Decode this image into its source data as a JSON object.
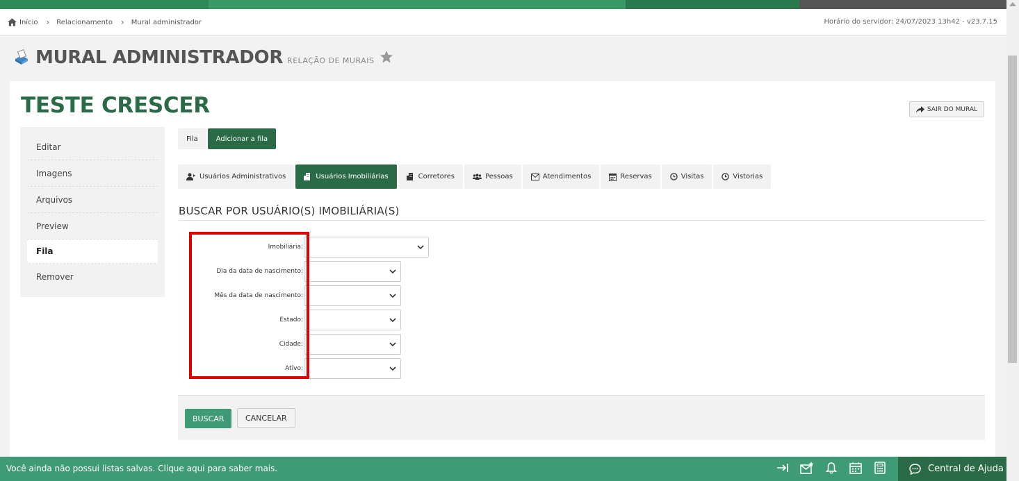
{
  "breadcrumb": {
    "items": [
      "Início",
      "Relacionamento",
      "Mural administrador"
    ]
  },
  "server_time": "Horário do servidor: 24/07/2023 13h42 - v23.7.15",
  "header": {
    "title": "MURAL ADMINISTRADOR",
    "subtitle": "RELAÇÃO DE MURAIS"
  },
  "mural": {
    "title": "TESTE CRESCER",
    "exit_label": "SAIR DO MURAL"
  },
  "sidenav": {
    "items": [
      {
        "label": "Editar",
        "active": false
      },
      {
        "label": "Imagens",
        "active": false
      },
      {
        "label": "Arquivos",
        "active": false
      },
      {
        "label": "Preview",
        "active": false
      },
      {
        "label": "Fila",
        "active": true
      },
      {
        "label": "Remover",
        "active": false
      }
    ]
  },
  "subtabs": [
    {
      "label": "Fila",
      "active": false
    },
    {
      "label": "Adicionar a fila",
      "active": true
    }
  ],
  "tabs": [
    {
      "label": "Usuários Administrativos",
      "icon": "user-arrow-icon",
      "active": false
    },
    {
      "label": "Usuários Imobiliárias",
      "icon": "building-icon",
      "active": true
    },
    {
      "label": "Corretores",
      "icon": "building-icon",
      "active": false
    },
    {
      "label": "Pessoas",
      "icon": "group-icon",
      "active": false
    },
    {
      "label": "Atendimentos",
      "icon": "envelope-icon",
      "active": false
    },
    {
      "label": "Reservas",
      "icon": "calendar-icon",
      "active": false
    },
    {
      "label": "Visitas",
      "icon": "clock-icon",
      "active": false
    },
    {
      "label": "Vistorias",
      "icon": "clock-icon",
      "active": false
    }
  ],
  "search": {
    "title": "BUSCAR POR USUÁRIO(S) IMOBILIÁRIA(S)",
    "fields": [
      {
        "label": "Imobiliária:",
        "value": ""
      },
      {
        "label": "Dia da data de nascimento:",
        "value": ""
      },
      {
        "label": "Mês da data de nascimento:",
        "value": ""
      },
      {
        "label": "Estado:",
        "value": ""
      },
      {
        "label": "Cidade:",
        "value": ""
      },
      {
        "label": "Ativo:",
        "value": ""
      }
    ],
    "search_label": "BUSCAR",
    "cancel_label": "CANCELAR"
  },
  "footer": {
    "message": "Você ainda não possui listas salvas. Clique aqui para saber mais.",
    "icons": [
      "collapse-right-icon",
      "mail-star-icon",
      "bell-icon",
      "calendar-icon",
      "calculator-icon"
    ],
    "help_label": "Central de Ajuda"
  },
  "colors": {
    "primary_dark": "#2a6a46",
    "primary": "#3f9b75",
    "highlight": "#e00000"
  }
}
